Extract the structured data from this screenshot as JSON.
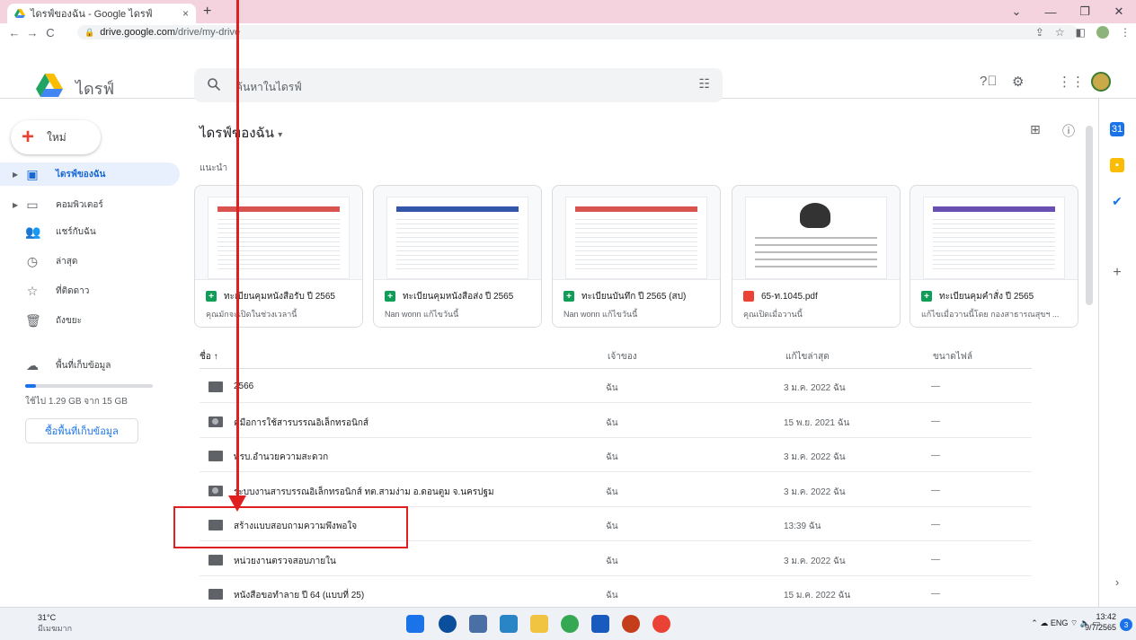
{
  "browser": {
    "tab_title": "ไดรฟ์ของฉัน - Google ไดรฟ์",
    "tab_close": "×",
    "new_tab": "+",
    "url_host": "drive.google.com",
    "url_path": "/drive/my-drive",
    "window_controls": [
      "⌄",
      "—",
      "❐",
      "✕"
    ]
  },
  "header": {
    "brand": "ไดรฟ์",
    "search_placeholder": "ค้นหาในไดรฟ์"
  },
  "sidebar": {
    "new_label": "ใหม่",
    "items": [
      {
        "label": "ไดรฟ์ของฉัน",
        "icon": "my-drive-icon",
        "active": true
      },
      {
        "label": "คอมพิวเตอร์",
        "icon": "computer-icon"
      },
      {
        "label": "แชร์กับฉัน",
        "icon": "shared-icon"
      },
      {
        "label": "ล่าสุด",
        "icon": "clock-icon"
      },
      {
        "label": "ที่ติดดาว",
        "icon": "star-icon"
      },
      {
        "label": "ถังขยะ",
        "icon": "trash-icon"
      }
    ],
    "storage_label": "พื้นที่เก็บข้อมูล",
    "storage_used": "ใช้ไป 1.29 GB จาก 15 GB",
    "storage_fraction": 0.086,
    "buy_storage": "ซื้อพื้นที่เก็บข้อมูล"
  },
  "main": {
    "title": "ไดรฟ์ของฉัน",
    "suggested_label": "แนะนำ",
    "suggested": [
      {
        "name": "ทะเบียนคุมหนังสือรับ ปี 2565",
        "sub": "คุณมักจะเปิดในช่วงเวลานี้",
        "type": "sheets"
      },
      {
        "name": "ทะเบียนคุมหนังสือส่ง ปี 2565",
        "sub": "Nan wonn แก้ไขวันนี้",
        "type": "sheets"
      },
      {
        "name": "ทะเบียนบันทึก ปี 2565 (สป)",
        "sub": "Nan wonn แก้ไขวันนี้",
        "type": "sheets"
      },
      {
        "name": "65-ท.1045.pdf",
        "sub": "คุณเปิดเมื่อวานนี้",
        "type": "pdf"
      },
      {
        "name": "ทะเบียนคุมคำสั่ง ปี 2565",
        "sub": "แก้ไขเมื่อวานนี้โดย กองสาธารณสุขฯ ...",
        "type": "sheets"
      }
    ],
    "columns": {
      "name": "ชื่อ ↑",
      "owner": "เจ้าของ",
      "modified": "แก้ไขล่าสุด",
      "size": "ขนาดไฟล์"
    },
    "files": [
      {
        "name": "2566",
        "owner": "ฉัน",
        "modified": "3 ม.ค. 2022 ฉัน",
        "size": "—",
        "shared": false
      },
      {
        "name": "คู่มือการใช้สารบรรณอิเล็กทรอนิกส์",
        "owner": "ฉัน",
        "modified": "15 พ.ย. 2021 ฉัน",
        "size": "—",
        "shared": true
      },
      {
        "name": "พรบ.อำนวยความสะดวก",
        "owner": "ฉัน",
        "modified": "3 ม.ค. 2022 ฉัน",
        "size": "—",
        "shared": false
      },
      {
        "name": "ระบบงานสารบรรณอิเล็กทรอนิกส์ ทต.สามง่าม อ.ดอนตูม จ.นครปฐม",
        "owner": "ฉัน",
        "modified": "3 ม.ค. 2022 ฉัน",
        "size": "—",
        "shared": true
      },
      {
        "name": "สร้างแบบสอบถามความพึงพอใจ",
        "owner": "ฉัน",
        "modified": "13:39 ฉัน",
        "size": "—",
        "shared": false
      },
      {
        "name": "หน่วยงานตรวจสอบภายใน",
        "owner": "ฉัน",
        "modified": "3 ม.ค. 2022 ฉัน",
        "size": "—",
        "shared": false
      },
      {
        "name": "หนังสือขอทำลาย ปี 64 (แบบที่ 25)",
        "owner": "ฉัน",
        "modified": "15 ม.ค. 2022 ฉัน",
        "size": "—",
        "shared": false
      }
    ]
  },
  "taskbar": {
    "temp": "31°C",
    "weather": "มีเมฆมาก",
    "lang": "ENG",
    "time": "13:42",
    "date": "9/7/2565",
    "notifications": "3"
  }
}
